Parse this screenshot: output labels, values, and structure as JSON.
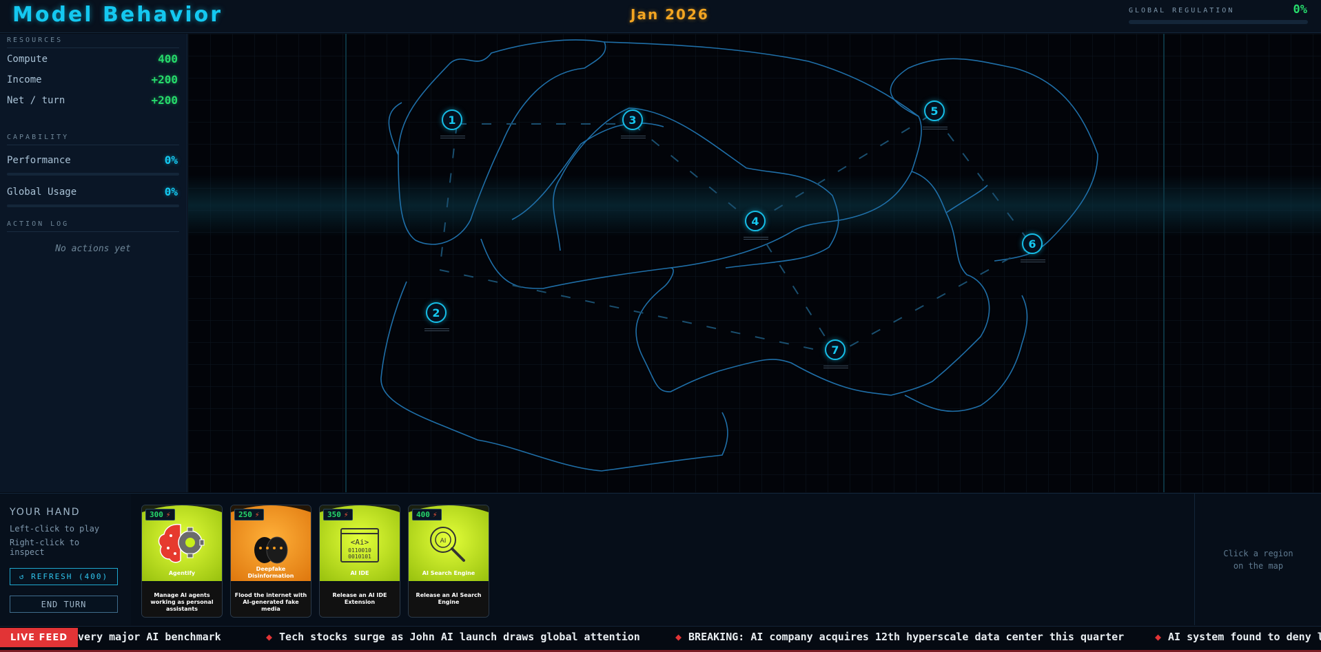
{
  "header": {
    "title": "Model Behavior",
    "date": "Jan 2026",
    "regulation_label": "GLOBAL REGULATION",
    "regulation_value": "0%",
    "regulation_fraction": 0
  },
  "sidebar": {
    "resources_title": "RESOURCES",
    "resources": [
      {
        "label": "Compute",
        "value": "400"
      },
      {
        "label": "Income",
        "value": "+200"
      },
      {
        "label": "Net / turn",
        "value": "+200"
      }
    ],
    "capability_title": "CAPABILITY",
    "capability": [
      {
        "label": "Performance",
        "value": "0%",
        "fraction": 0
      },
      {
        "label": "Global Usage",
        "value": "0%",
        "fraction": 0
      }
    ],
    "action_log_title": "ACTION LOG",
    "action_log_empty": "No actions yet"
  },
  "map": {
    "line_color": "#1f6fa8",
    "node_color": "#16bde6",
    "regions": [
      {
        "label": "1"
      },
      {
        "label": "2"
      },
      {
        "label": "3"
      },
      {
        "label": "4"
      },
      {
        "label": "5"
      },
      {
        "label": "6"
      },
      {
        "label": "7"
      }
    ]
  },
  "hand": {
    "title": "YOUR HAND",
    "help_left": "Left-click to play",
    "help_right": "Right-click to inspect",
    "refresh_label": "↺ REFRESH (400)",
    "end_turn_label": "END TURN",
    "cards": [
      {
        "cost": "300",
        "name": "Agentify",
        "desc": "Manage AI agents working as personal assistants",
        "icon": "brain-gear-icon",
        "color": "#c8ef1a"
      },
      {
        "cost": "250",
        "name": "Deepfake Disinformation",
        "desc": "Flood the internet with AI-generated fake media",
        "icon": "faces-icon",
        "color": "#f39b1f"
      },
      {
        "cost": "350",
        "name": "AI IDE",
        "desc": "Release an AI IDE Extension",
        "icon": "ai-code-window-icon",
        "color": "#c8ef1a"
      },
      {
        "cost": "400",
        "name": "AI Search Engine",
        "desc": "Release an AI Search Engine",
        "icon": "ai-magnifier-icon",
        "color": "#c8ef1a"
      }
    ]
  },
  "inspect": {
    "hint": "Click a region\non the map"
  },
  "ticker": {
    "live_label": "LIVE FEED",
    "items": [
      "very major AI benchmark",
      "Tech stocks surge as John AI launch draws global attention",
      "BREAKING: AI company acquires 12th hyperscale data center this quarter",
      "AI system found to deny lo"
    ]
  }
}
